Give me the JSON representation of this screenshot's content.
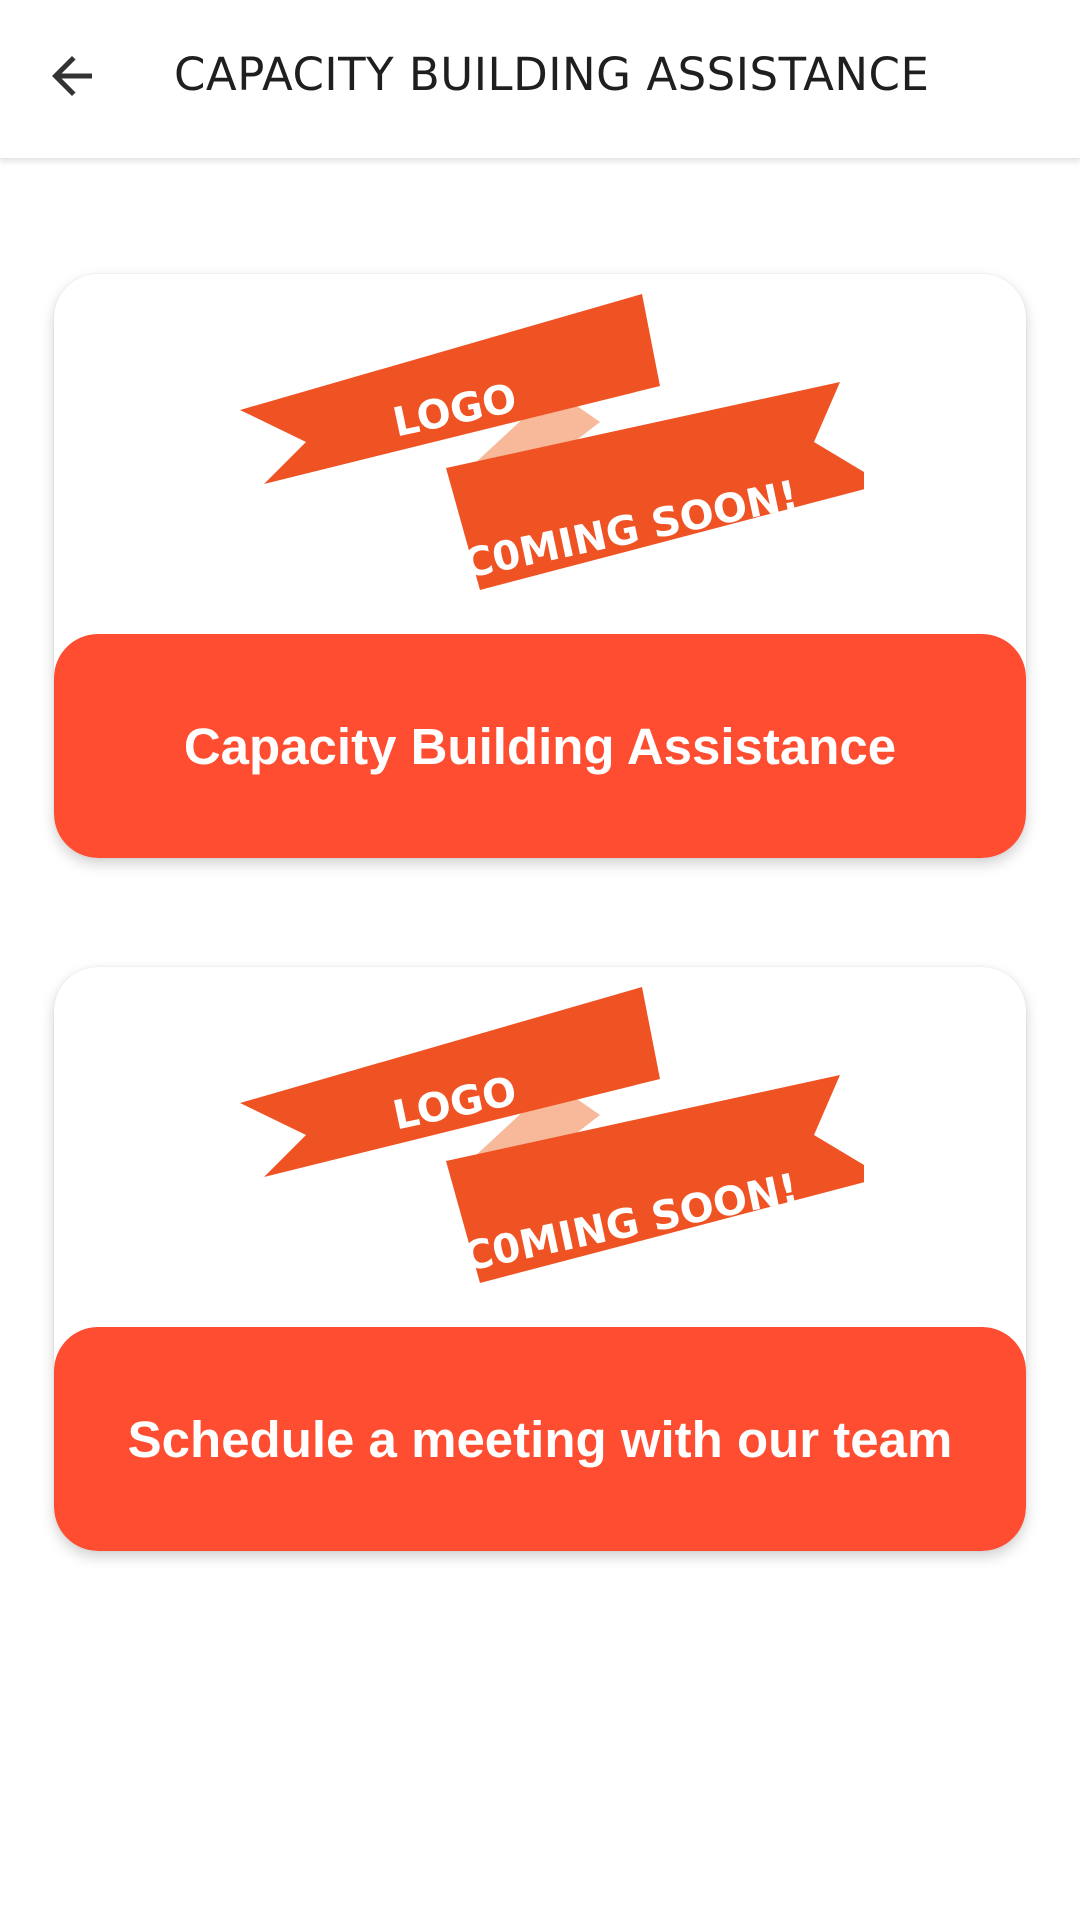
{
  "header": {
    "title": "CAPACITY BUILDING ASSISTANCE",
    "back_icon": "arrow-back-icon"
  },
  "cards": [
    {
      "logo": {
        "line1": "LOGO",
        "line2": "C0MING SOON!"
      },
      "label": "Capacity Building Assistance"
    },
    {
      "logo": {
        "line1": "LOGO",
        "line2": "C0MING SOON!"
      },
      "label": "Schedule a meeting with our team"
    }
  ],
  "colors": {
    "accent": "#ff4d31",
    "ribbon": "#f05323",
    "ribbon_fold": "#f7b99a",
    "title_text": "#1f1f1f"
  }
}
